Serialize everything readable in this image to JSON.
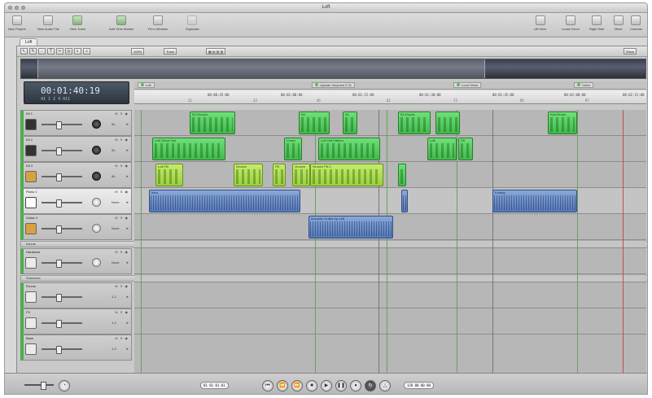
{
  "window": {
    "title": "Loft"
  },
  "toolbar": {
    "left": [
      {
        "label": "New Project",
        "icon": "new-project-icon"
      },
      {
        "label": "New Audio File",
        "icon": "new-audio-file-icon"
      },
      {
        "label": "New Track",
        "icon": "new-track-icon"
      },
      {
        "label": "Add Time Marker",
        "icon": "add-marker-icon"
      },
      {
        "label": "Fit in Window",
        "icon": "fit-window-icon"
      },
      {
        "label": "Duplicate",
        "icon": "duplicate-icon"
      }
    ],
    "right": [
      {
        "label": "Lift Here",
        "icon": "lift-icon"
      },
      {
        "label": "Loose Drum",
        "icon": "drum-icon"
      },
      {
        "label": "Right Side",
        "icon": "right-side-icon"
      },
      {
        "label": "Mixer",
        "icon": "mixer-icon"
      },
      {
        "label": "Controls",
        "icon": "controls-icon"
      }
    ]
  },
  "tab": {
    "label": "Loft"
  },
  "arrange_toolbar": {
    "zoom_label": "100%",
    "snap_label": "Track",
    "right_menu": "Show"
  },
  "lcd": {
    "time": "00:01:40:19",
    "bars": "41  1  2 4 011",
    "prefix": "time"
  },
  "markers": [
    {
      "label": "Loft"
    },
    {
      "label": "Update Joinpoint 2.01"
    },
    {
      "label": "Loud Verse"
    },
    {
      "label": "Outro"
    }
  ],
  "ruler": {
    "times": [
      "00:00:45:00",
      "00:01:00:00",
      "00:01:15:00",
      "00:01:30:00",
      "00:01:45:00",
      "00:02:00:00",
      "00:02:15:00",
      "00:02:30:00"
    ],
    "bars": [
      "21",
      "33",
      "45",
      "61",
      "73",
      "85",
      "97",
      "109"
    ]
  },
  "tracks": [
    {
      "name": "Kit 1",
      "value": "0b",
      "instrument": "kit-icon"
    },
    {
      "name": "Kit 2",
      "value": "0b",
      "instrument": "kit-icon"
    },
    {
      "name": "Kit 3",
      "value": "0b",
      "instrument": "guitar-icon"
    },
    {
      "name": "Piano 1",
      "value": "None",
      "instrument": "piano-icon"
    },
    {
      "name": "Guitar 2",
      "value": "None",
      "instrument": "guitar-icon"
    }
  ],
  "groups": [
    {
      "label": "Drums"
    },
    {
      "label": "Hardware"
    },
    {
      "label": "Submixes"
    }
  ],
  "sub_tracks": [
    {
      "name": "Hardware",
      "value": "None"
    },
    {
      "name": "Drums",
      "value": "1-2"
    },
    {
      "name": "FX",
      "value": "1-2"
    },
    {
      "name": "Bass",
      "value": "1-2"
    }
  ],
  "regions": [
    {
      "lane": 0,
      "label": "Kit Groove",
      "style": "green"
    },
    {
      "lane": 0,
      "label": "Kit",
      "style": "green"
    },
    {
      "lane": 0,
      "label": "Kit",
      "style": "green"
    },
    {
      "lane": 0,
      "label": "Kit Drums",
      "style": "green"
    },
    {
      "lane": 0,
      "label": "",
      "style": "green"
    },
    {
      "lane": 0,
      "label": "Kick/Snare",
      "style": "green"
    },
    {
      "lane": 1,
      "label": "Loft Ghost Hat",
      "style": "green"
    },
    {
      "lane": 1,
      "label": "Crash",
      "style": "green"
    },
    {
      "lane": 1,
      "label": "Loft Hat Pattern",
      "style": "green"
    },
    {
      "lane": 1,
      "label": "Loft",
      "style": "green"
    },
    {
      "lane": 1,
      "label": "Fill",
      "style": "green"
    },
    {
      "lane": 2,
      "label": "Loft Fill",
      "style": "lime"
    },
    {
      "lane": 2,
      "label": "Groove",
      "style": "lime"
    },
    {
      "lane": 2,
      "label": "Fill",
      "style": "lime"
    },
    {
      "lane": 2,
      "label": "Groove",
      "style": "lime"
    },
    {
      "lane": 2,
      "label": "Groove Fill 2",
      "style": "lime"
    },
    {
      "lane": 2,
      "label": "",
      "style": "green"
    },
    {
      "lane": 3,
      "label": "Intro",
      "style": "blue"
    },
    {
      "lane": 3,
      "label": "",
      "style": "blue"
    },
    {
      "lane": 3,
      "label": "Ending",
      "style": "blue"
    },
    {
      "lane": 4,
      "label": "Acoustic Guitar Up Loft",
      "style": "blue"
    }
  ],
  "transport": {
    "position": "01 01 01 01",
    "tempo": "128 00 00 00",
    "buttons": [
      "go-to-start-icon",
      "rewind-icon",
      "forward-icon",
      "stop-icon",
      "play-icon",
      "pause-icon",
      "record-icon",
      "cycle-icon",
      "metronome-icon"
    ]
  }
}
